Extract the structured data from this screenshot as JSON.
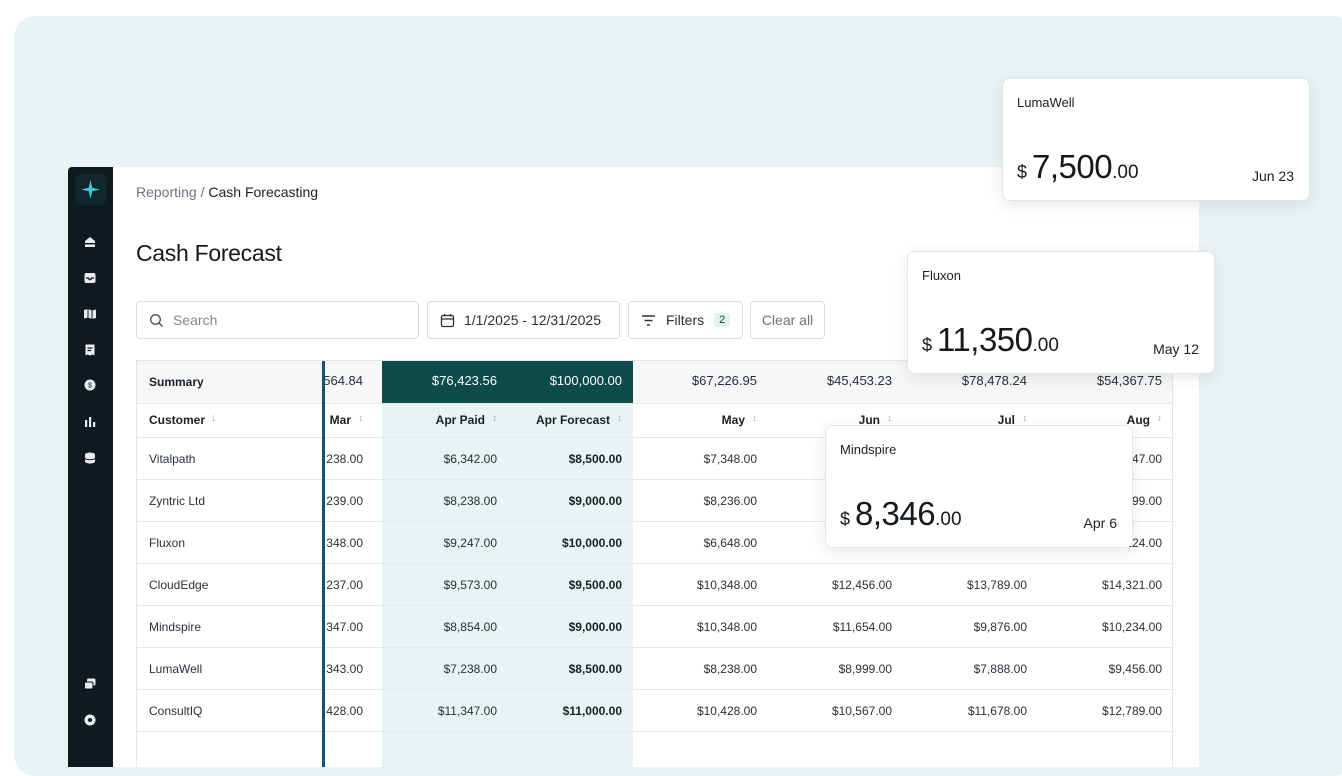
{
  "breadcrumb": {
    "parent": "Reporting",
    "separator": " / ",
    "current": "Cash Forecasting"
  },
  "page_title": "Cash Forecast",
  "toolbar": {
    "search_placeholder": "Search",
    "date_range": "1/1/2025 - 12/31/2025",
    "filters_label": "Filters",
    "filters_count": "2",
    "clear_label": "Clear all"
  },
  "sidebar_icons": [
    "spark-logo-icon",
    "home-icon",
    "inbox-icon",
    "map-icon",
    "receipt-icon",
    "coin-icon",
    "bar-chart-icon",
    "database-icon",
    "stack-icon",
    "settings-icon"
  ],
  "table": {
    "summary_label": "Summary",
    "customer_header": "Customer",
    "summary": [
      "564.84",
      "$76,423.56",
      "$100,000.00",
      "$67,226.95",
      "$45,453.23",
      "$78,478.24",
      "$54,367.75"
    ],
    "columns": [
      "Mar",
      "Apr Paid",
      "Apr Forecast",
      "May",
      "Jun",
      "Jul",
      "Aug"
    ],
    "rows": [
      {
        "customer": "Vitalpath",
        "values": [
          "238.00",
          "$6,342.00",
          "$8,500.00",
          "$7,348.00",
          "",
          "",
          "47.00"
        ]
      },
      {
        "customer": "Zyntric Ltd",
        "values": [
          "239.00",
          "$8,238.00",
          "$9,000.00",
          "$8,236.00",
          "",
          "",
          "99.00"
        ]
      },
      {
        "customer": "Fluxon",
        "values": [
          "348.00",
          "$9,247.00",
          "$10,000.00",
          "$6,648.00",
          "",
          "",
          "124.00"
        ]
      },
      {
        "customer": "CloudEdge",
        "values": [
          "237.00",
          "$9,573.00",
          "$9,500.00",
          "$10,348.00",
          "$12,456.00",
          "$13,789.00",
          "$14,321.00"
        ]
      },
      {
        "customer": "Mindspire",
        "values": [
          "347.00",
          "$8,854.00",
          "$9,000.00",
          "$10,348.00",
          "$11,654.00",
          "$9,876.00",
          "$10,234.00"
        ]
      },
      {
        "customer": "LumaWell",
        "values": [
          "343.00",
          "$7,238.00",
          "$8,500.00",
          "$8,238.00",
          "$8,999.00",
          "$7,888.00",
          "$9,456.00"
        ]
      },
      {
        "customer": "ConsultIQ",
        "values": [
          "428.00",
          "$11,347.00",
          "$11,000.00",
          "$10,428.00",
          "$10,567.00",
          "$11,678.00",
          "$12,789.00"
        ]
      }
    ]
  },
  "cards": [
    {
      "name": "LumaWell",
      "currency": "$",
      "amount": "7,500",
      "cents": ".00",
      "date": "Jun 23"
    },
    {
      "name": "Fluxon",
      "currency": "$",
      "amount": "11,350",
      "cents": ".00",
      "date": "May 12"
    },
    {
      "name": "Mindspire",
      "currency": "$",
      "amount": "8,346",
      "cents": ".00",
      "date": "Apr 6"
    }
  ],
  "colors": {
    "accent_dark": "#0d4a4b",
    "accent_tint": "#e8f4f3",
    "sidebar": "#0e1a1f",
    "freeze_line": "#15546c"
  }
}
